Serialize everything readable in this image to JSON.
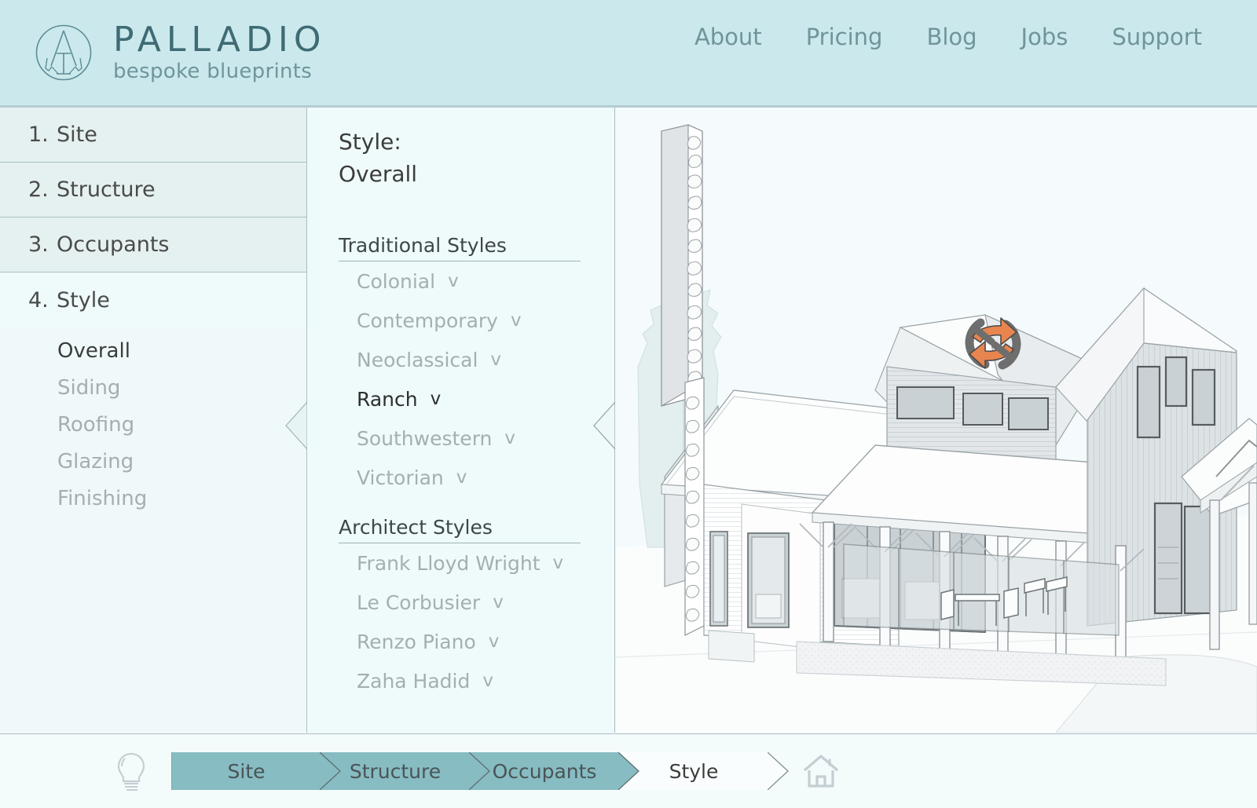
{
  "header": {
    "logo_icon": "palladio-circle-a-logo",
    "brand_name": "PALLADIO",
    "brand_tagline": "bespoke blueprints",
    "nav": [
      {
        "label": "About"
      },
      {
        "label": "Pricing"
      },
      {
        "label": "Blog"
      },
      {
        "label": "Jobs"
      },
      {
        "label": "Support"
      }
    ]
  },
  "sidebar": {
    "steps": [
      {
        "num": "1.",
        "label": "Site",
        "active": false
      },
      {
        "num": "2.",
        "label": "Structure",
        "active": false
      },
      {
        "num": "3.",
        "label": "Occupants",
        "active": false
      },
      {
        "num": "4.",
        "label": "Style",
        "active": true
      }
    ],
    "substeps": [
      {
        "label": "Overall",
        "selected": true
      },
      {
        "label": "Siding",
        "selected": false
      },
      {
        "label": "Roofing",
        "selected": false
      },
      {
        "label": "Glazing",
        "selected": false
      },
      {
        "label": "Finishing",
        "selected": false
      }
    ],
    "collapse_handle_icon": "chevron-left-handle-icon"
  },
  "panel": {
    "title": "Style:",
    "subtitle": "Overall",
    "collapse_handle_icon": "chevron-left-handle-icon",
    "groups": [
      {
        "heading": "Traditional Styles",
        "options": [
          {
            "label": "Colonial",
            "chevron": "v",
            "selected": false
          },
          {
            "label": "Contemporary",
            "chevron": "v",
            "selected": false
          },
          {
            "label": "Neoclassical",
            "chevron": "v",
            "selected": false
          },
          {
            "label": "Ranch",
            "chevron": "v",
            "selected": true
          },
          {
            "label": "Southwestern",
            "chevron": "v",
            "selected": false
          },
          {
            "label": "Victorian",
            "chevron": "v",
            "selected": false
          }
        ]
      },
      {
        "heading": "Architect Styles",
        "options": [
          {
            "label": "Frank Lloyd Wright",
            "chevron": "v",
            "selected": false
          },
          {
            "label": "Le Corbusier",
            "chevron": "v",
            "selected": false
          },
          {
            "label": "Renzo Piano",
            "chevron": "v",
            "selected": false
          },
          {
            "label": "Zaha Hadid",
            "chevron": "v",
            "selected": false
          }
        ]
      }
    ]
  },
  "viewport": {
    "name": "house-3d-preview",
    "orbit_gizmo_icon": "orbit-rotate-gizmo-icon",
    "background_color": "#f5fbfc"
  },
  "bottombar": {
    "hint_icon": "lightbulb-icon",
    "home_icon": "home-icon",
    "crumbs": [
      {
        "label": "Site",
        "state": "done"
      },
      {
        "label": "Structure",
        "state": "done"
      },
      {
        "label": "Occupants",
        "state": "done"
      },
      {
        "label": "Style",
        "state": "current"
      }
    ]
  },
  "colors": {
    "header_bg": "#cbe9ec",
    "brand": "#3f6b75",
    "nav_text": "#6f959c",
    "sidebar_bg": "#eff9f9",
    "step_bg": "#e5f1f0",
    "panel_bg": "#effafa",
    "viewport_bg": "#f5fbfc",
    "crumb_done": "#86bcc2",
    "crumb_current": "#fafdfd",
    "border": "#a9bec4",
    "gizmo_orange": "#e8854f",
    "gizmo_gray": "#6e6e6e"
  }
}
